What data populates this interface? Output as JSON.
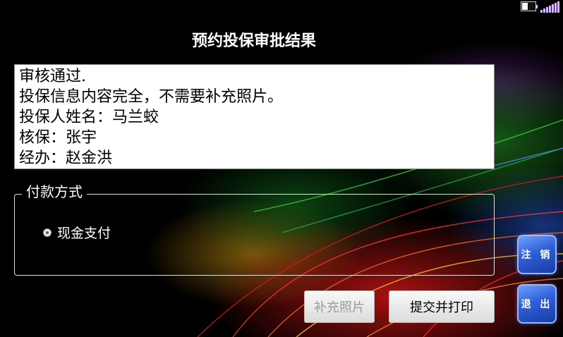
{
  "window": {
    "title": "预约投保审批结果"
  },
  "result": {
    "lines": [
      "审核通过.",
      "投保信息内容完全，不需要补充照片。",
      "投保人姓名：马兰蛟",
      "核保：张宇",
      "经办：赵金洪"
    ]
  },
  "payment": {
    "legend": "付款方式",
    "options": [
      {
        "label": "现金支付",
        "selected": true
      }
    ]
  },
  "buttons": {
    "supplement_photo": {
      "label": "补充照片",
      "enabled": false
    },
    "submit_print": {
      "label": "提交并打印",
      "enabled": true
    },
    "logout": {
      "label": "注 销"
    },
    "exit": {
      "label": "退 出"
    }
  },
  "status": {
    "battery_icon": "battery-icon",
    "signal_icon": "signal-strength-icon"
  }
}
